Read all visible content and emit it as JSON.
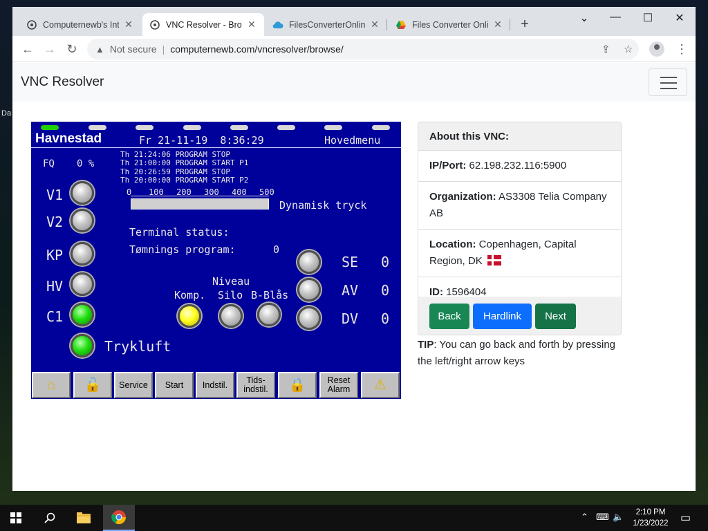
{
  "browser": {
    "tabs": [
      {
        "title": "Computernewb's Inte",
        "active": false,
        "icon": "site-favicon"
      },
      {
        "title": "VNC Resolver - Brow",
        "active": true,
        "icon": "site-favicon"
      },
      {
        "title": "FilesConverterOnline",
        "active": false,
        "icon": "cloud-favicon"
      },
      {
        "title": "Files Converter Onlin",
        "active": false,
        "icon": "drive-favicon"
      }
    ],
    "new_tab": "+",
    "not_secure": "Not secure",
    "url": "computernewb.com/vncresolver/browse/"
  },
  "navbar": {
    "brand": "VNC Resolver"
  },
  "hmi": {
    "site": "Havnestad",
    "datetime": "Fr 21-11-19  8:36:29",
    "menu": "Hovedmenu",
    "fq_label": "FQ",
    "fq_value": "0 %",
    "log": [
      "Th 21:24:06 PROGRAM STOP",
      "Th 21:00:00 PROGRAM START P1",
      "Th 20:26:59 PROGRAM STOP",
      "Th 20:00:00 PROGRAM START P2"
    ],
    "scale": [
      "0",
      "100",
      "200",
      "300",
      "400",
      "500"
    ],
    "bar_label": "Dynamisk tryck",
    "terminal_status": "Terminal status:",
    "program_label": "Tømnings program:",
    "program_value": "0",
    "niveau": "Niveau",
    "komp": "Komp.",
    "silo": "Silo",
    "bblas": "B-Blås",
    "left_labels": [
      "V1",
      "V2",
      "KP",
      "HV",
      "C1"
    ],
    "trykluft": "Trykluft",
    "right_labels": [
      {
        "label": "SE",
        "value": "0"
      },
      {
        "label": "AV",
        "value": "0"
      },
      {
        "label": "DV",
        "value": "0"
      }
    ],
    "buttons": {
      "service": "Service",
      "start": "Start",
      "indstil": "Indstil.",
      "tids1": "Tids-",
      "tids2": "indstil.",
      "reset1": "Reset",
      "reset2": "Alarm"
    }
  },
  "about": {
    "header": "About this VNC:",
    "ip_label": "IP/Port:",
    "ip_value": "62.198.232.116:5900",
    "org_label": "Organization:",
    "org_value": "AS3308 Telia Company AB",
    "loc_label": "Location:",
    "loc_value": "Copenhagen, Capital Region, DK",
    "id_label": "ID:",
    "id_value": "1596404",
    "back": "Back",
    "hardlink": "Hardlink",
    "next": "Next",
    "tip_label": "TIP",
    "tip_text": ": You can go back and forth by pressing the left/right arrow keys"
  },
  "taskbar": {
    "time": "2:10 PM",
    "date": "1/23/2022"
  },
  "desktop": {
    "glyphs": [
      "Da"
    ]
  }
}
